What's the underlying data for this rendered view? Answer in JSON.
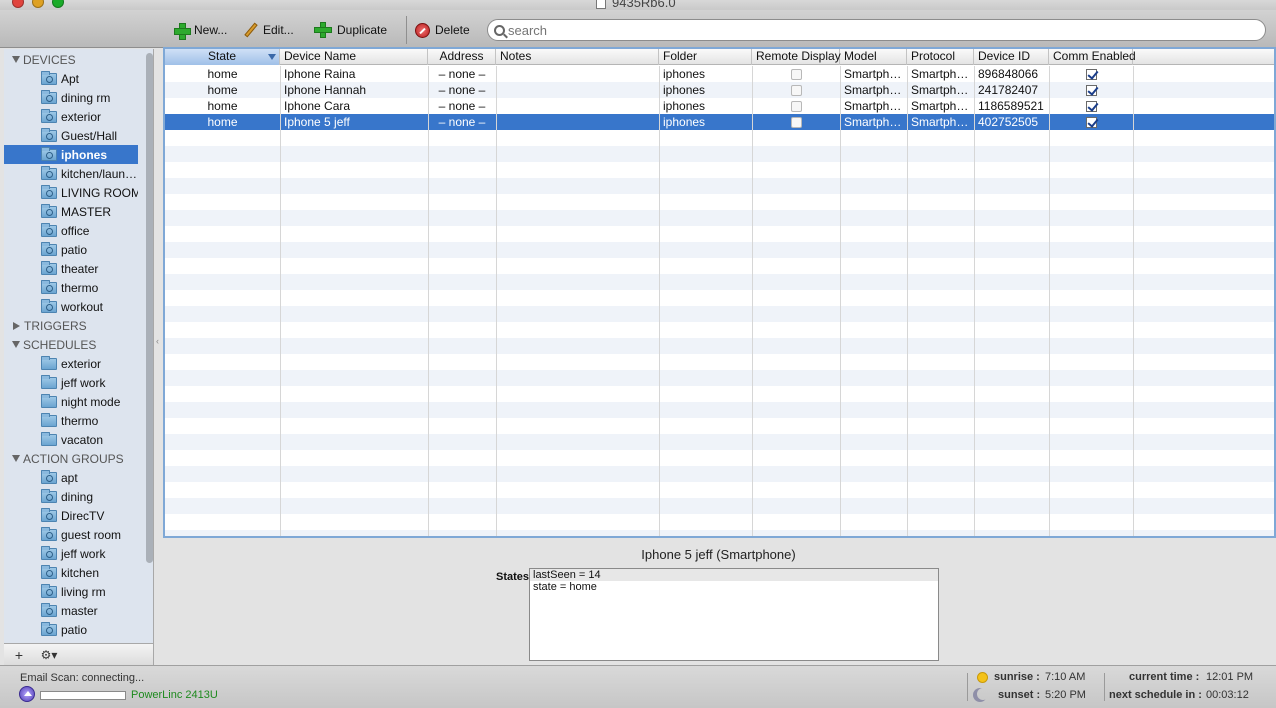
{
  "window": {
    "title": "9435Rb6.0"
  },
  "toolbar": {
    "new_label": "New...",
    "edit_label": "Edit...",
    "duplicate_label": "Duplicate",
    "delete_label": "Delete",
    "search_placeholder": "search"
  },
  "sidebar": {
    "devices_label": "DEVICES",
    "devices": [
      "Apt",
      "dining rm",
      "exterior",
      "Guest/Hall",
      "iphones",
      "kitchen/laun…",
      "LIVING ROOM",
      "MASTER",
      "office",
      "patio",
      "theater",
      "thermo",
      "workout"
    ],
    "selected_device": "iphones",
    "triggers_label": "TRIGGERS",
    "schedules_label": "SCHEDULES",
    "schedules": [
      "exterior",
      "jeff work",
      "night mode",
      "thermo",
      "vacaton"
    ],
    "action_groups_label": "ACTION GROUPS",
    "action_groups": [
      "apt",
      "dining",
      "DirecTV",
      "guest room",
      "jeff work",
      "kitchen",
      "living rm",
      "master",
      "patio"
    ],
    "footer_add": "+",
    "footer_gear": "⚙▾"
  },
  "table": {
    "columns": [
      "State",
      "Device Name",
      "Address",
      "Notes",
      "Folder",
      "Remote Display",
      "Model",
      "Protocol",
      "Device ID",
      "Comm Enabled"
    ],
    "rows": [
      {
        "state": "home",
        "name": "Iphone Raina",
        "address": "– none –",
        "notes": "",
        "folder": "iphones",
        "remote_display": false,
        "model": "Smartph…",
        "protocol": "Smartph…",
        "device_id": "896848066",
        "comm_enabled": true
      },
      {
        "state": "home",
        "name": "Iphone Hannah",
        "address": "– none –",
        "notes": "",
        "folder": "iphones",
        "remote_display": false,
        "model": "Smartph…",
        "protocol": "Smartph…",
        "device_id": "241782407",
        "comm_enabled": true
      },
      {
        "state": "home",
        "name": "Iphone Cara",
        "address": "– none –",
        "notes": "",
        "folder": "iphones",
        "remote_display": false,
        "model": "Smartph…",
        "protocol": "Smartph…",
        "device_id": "1186589521",
        "comm_enabled": true
      },
      {
        "state": "home",
        "name": "Iphone 5 jeff",
        "address": "– none –",
        "notes": "",
        "folder": "iphones",
        "remote_display": false,
        "model": "Smartph…",
        "protocol": "Smartph…",
        "device_id": "402752505",
        "comm_enabled": true
      }
    ],
    "selected_row": 3
  },
  "detail": {
    "title": "Iphone 5 jeff (Smartphone)",
    "states_label": "States:",
    "states": [
      "lastSeen = 14",
      "state = home"
    ]
  },
  "status": {
    "email_scan": "Email Scan: connecting...",
    "interface": "PowerLinc 2413U",
    "sunrise_label": "sunrise :",
    "sunrise_value": "7:10 AM",
    "sunset_label": "sunset :",
    "sunset_value": "5:20 PM",
    "current_time_label": "current time :",
    "current_time_value": "12:01 PM",
    "next_schedule_label": "next schedule in :",
    "next_schedule_value": "00:03:12"
  },
  "colors": {
    "selection": "#3876cb",
    "sidebar_bg": "#dde4ee",
    "status_green": "#1e8a1e"
  }
}
